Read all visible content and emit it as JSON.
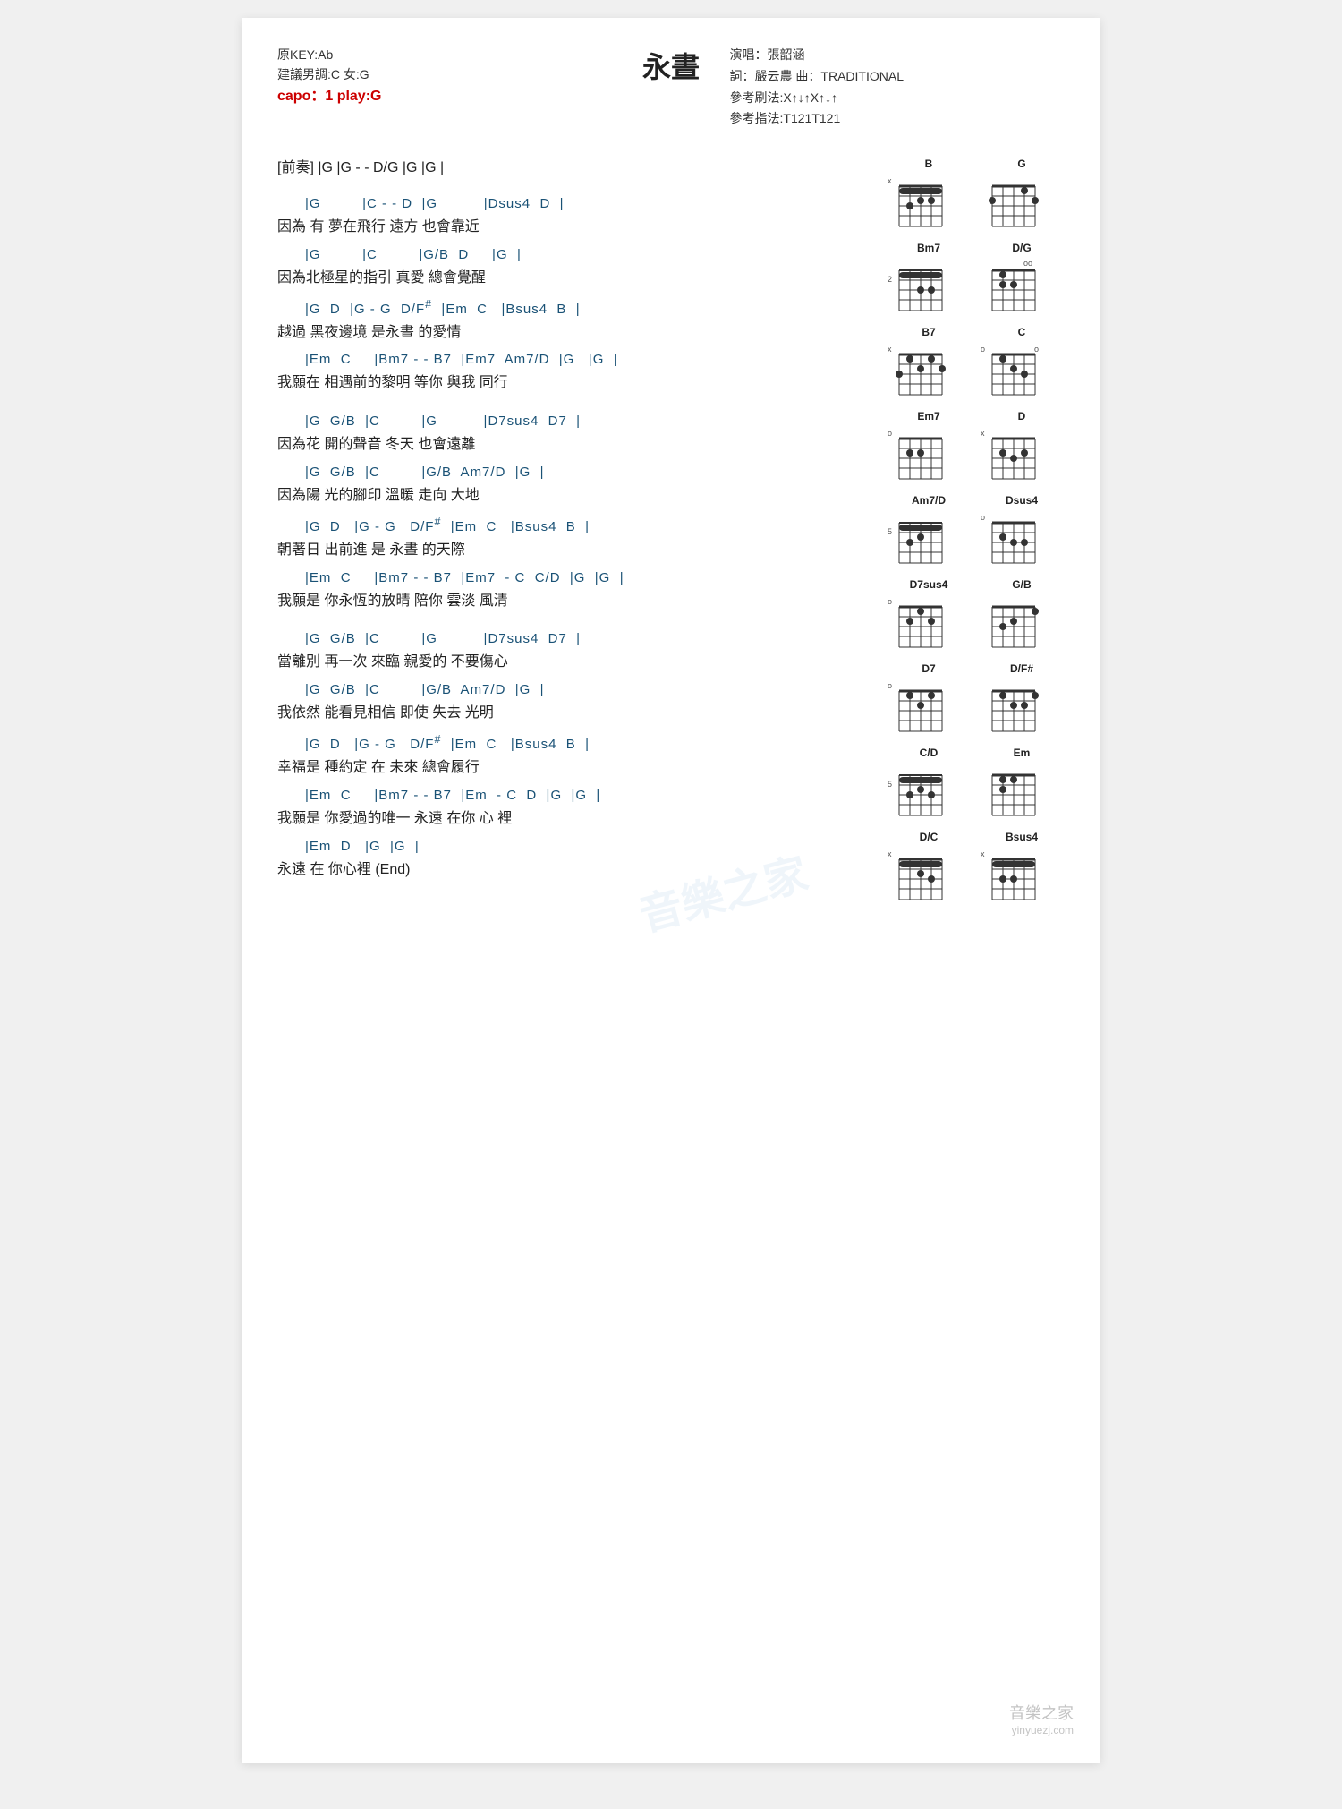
{
  "title": "永晝",
  "meta": {
    "original_key": "原KEY:Ab",
    "suggested_key": "建議男調:C 女:G",
    "capo": "capo：1 play:G",
    "performer": "演唱：張韶涵",
    "lyricist": "詞：嚴云農  曲：TRADITIONAL",
    "strum_pattern": "參考刷法:X↑↓↑X↑↓↑",
    "finger_pattern": "參考指法:T121T121"
  },
  "intro": "[前奏] |G   |G - - D/G  |G   |G  |",
  "sections": [
    {
      "chords": "      |G         |C - - D  |G          |Dsus4  D  |",
      "lyrics": "因為 有 夢在飛行    遠方  也會靠近"
    },
    {
      "chords": "      |G         |C         |G/B  D     |G  |",
      "lyrics": "因為北極星的指引    真愛    總會覺醒"
    },
    {
      "chords": "      |G  D  |G - G  D/F#  |Em  C   |Bsus4  B  |",
      "lyrics": "越過  黑夜邊境                是永晝    的愛情"
    },
    {
      "chords": "      |Em  C     |Bm7 - - B7  |Em7  Am7/D  |G   |G  |",
      "lyrics": "我願在 相遇前的黎明       等你       與我      同行"
    }
  ],
  "sections2": [
    {
      "chords": "      |G  G/B  |C         |G          |D7sus4  D7  |",
      "lyrics": "因為花  開的聲音    冬天 也會遠離"
    },
    {
      "chords": "      |G  G/B  |C         |G/B  Am7/D  |G  |",
      "lyrics": "因為陽   光的腳印    溫暖    走向   大地"
    },
    {
      "chords": "      |G  D   |G - G   D/F#  |Em  C   |Bsus4  B  |",
      "lyrics": "朝著日   出前進            是  永晝    的天際"
    },
    {
      "chords": "      |Em  C     |Bm7 - - B7  |Em7  - C  C/D  |G  |G  |",
      "lyrics": "我願是 你永恆的放晴       陪你       雲淡      風清"
    }
  ],
  "sections3": [
    {
      "chords": "      |G  G/B  |C         |G          |D7sus4  D7  |",
      "lyrics": "當離別 再一次  來臨    親愛的 不要傷心"
    },
    {
      "chords": "      |G  G/B  |C         |G/B  Am7/D  |G  |",
      "lyrics": "我依然 能看見相信    即使   失去     光明"
    },
    {
      "chords": "      |G  D   |G - G   D/F#  |Em  C   |Bsus4  B  |",
      "lyrics": "幸福是  種約定         在   未來    總會履行"
    },
    {
      "chords": "      |Em  C     |Bm7 - - B7  |Em  - C  D  |G  |G  |",
      "lyrics": "我願是 你愛過的唯一       永遠       在你 心  裡"
    },
    {
      "chords": "      |Em  D   |G  |G  |",
      "lyrics": "永遠  在 你心裡        (End)"
    }
  ],
  "chord_diagrams": [
    {
      "name": "B",
      "fret_offset": "x",
      "positions": [
        [
          1,
          1
        ],
        [
          2,
          1
        ],
        [
          3,
          1
        ],
        [
          4,
          1
        ],
        [
          5,
          1
        ]
      ],
      "fret_num": null
    },
    {
      "name": "G",
      "fret_offset": null,
      "positions": [
        [
          1,
          3
        ],
        [
          5,
          2
        ],
        [
          6,
          3
        ]
      ],
      "fret_num": null
    },
    {
      "name": "Bm7",
      "fret_offset": "2",
      "positions": [
        [
          1,
          1
        ],
        [
          2,
          1
        ],
        [
          3,
          1
        ],
        [
          4,
          1
        ],
        [
          5,
          1
        ]
      ],
      "fret_num": "2"
    },
    {
      "name": "D/G",
      "fret_offset": "oo",
      "positions": [
        [
          3,
          2
        ],
        [
          4,
          3
        ],
        [
          5,
          2
        ]
      ],
      "fret_num": null
    },
    {
      "name": "B7",
      "fret_offset": "x",
      "positions": [
        [
          1,
          1
        ],
        [
          2,
          2
        ],
        [
          3,
          1
        ],
        [
          4,
          3
        ],
        [
          5,
          2
        ]
      ],
      "fret_num": null
    },
    {
      "name": "C",
      "fret_offset": "o",
      "positions": [
        [
          2,
          1
        ],
        [
          3,
          2
        ],
        [
          4,
          3
        ],
        [
          5,
          3
        ]
      ],
      "fret_num": null
    },
    {
      "name": "Em7",
      "fret_offset": "o",
      "positions": [
        [
          1,
          0
        ],
        [
          2,
          2
        ],
        [
          3,
          2
        ]
      ],
      "fret_num": null
    },
    {
      "name": "D",
      "fret_offset": "x",
      "positions": [
        [
          1,
          2
        ],
        [
          2,
          3
        ],
        [
          3,
          2
        ]
      ],
      "fret_num": null
    },
    {
      "name": "Am7/D",
      "fret_offset": "5",
      "positions": [
        [
          1,
          1
        ],
        [
          2,
          1
        ],
        [
          3,
          1
        ],
        [
          4,
          1
        ],
        [
          5,
          1
        ]
      ],
      "fret_num": "5"
    },
    {
      "name": "Dsus4",
      "fret_offset": "o",
      "positions": [
        [
          1,
          2
        ],
        [
          2,
          3
        ],
        [
          3,
          3
        ]
      ],
      "fret_num": null
    },
    {
      "name": "D7sus4",
      "fret_offset": "o",
      "positions": [
        [
          1,
          2
        ],
        [
          2,
          3
        ],
        [
          3,
          1
        ]
      ],
      "fret_num": null
    },
    {
      "name": "G/B",
      "fret_offset": null,
      "positions": [
        [
          5,
          2
        ],
        [
          4,
          3
        ],
        [
          3,
          4
        ]
      ],
      "fret_num": null
    },
    {
      "name": "D7",
      "fret_offset": "o",
      "positions": [
        [
          1,
          2
        ],
        [
          2,
          1
        ],
        [
          3,
          2
        ]
      ],
      "fret_num": null
    },
    {
      "name": "D/F#",
      "fret_offset": null,
      "positions": [
        [
          5,
          2
        ],
        [
          4,
          3
        ],
        [
          3,
          2
        ],
        [
          2,
          1
        ]
      ],
      "fret_num": null
    },
    {
      "name": "C/D",
      "fret_offset": "5",
      "positions": [
        [
          1,
          1
        ],
        [
          2,
          1
        ],
        [
          3,
          1
        ],
        [
          4,
          1
        ],
        [
          5,
          1
        ],
        [
          6,
          1
        ]
      ],
      "fret_num": "5"
    },
    {
      "name": "Em",
      "fret_offset": null,
      "positions": [
        [
          2,
          2
        ],
        [
          3,
          2
        ]
      ],
      "fret_num": null
    },
    {
      "name": "D/C",
      "fret_offset": "x",
      "positions": [
        [
          1,
          1
        ],
        [
          2,
          2
        ],
        [
          3,
          3
        ],
        [
          4,
          2
        ]
      ],
      "fret_num": null
    },
    {
      "name": "Bsus4",
      "fret_offset": "x",
      "positions": [
        [
          1,
          1
        ],
        [
          2,
          1
        ],
        [
          3,
          1
        ],
        [
          4,
          1
        ],
        [
          5,
          1
        ]
      ],
      "fret_num": null
    }
  ],
  "watermark": {
    "logo": "音樂之家",
    "url": "yinyuezj.com"
  }
}
